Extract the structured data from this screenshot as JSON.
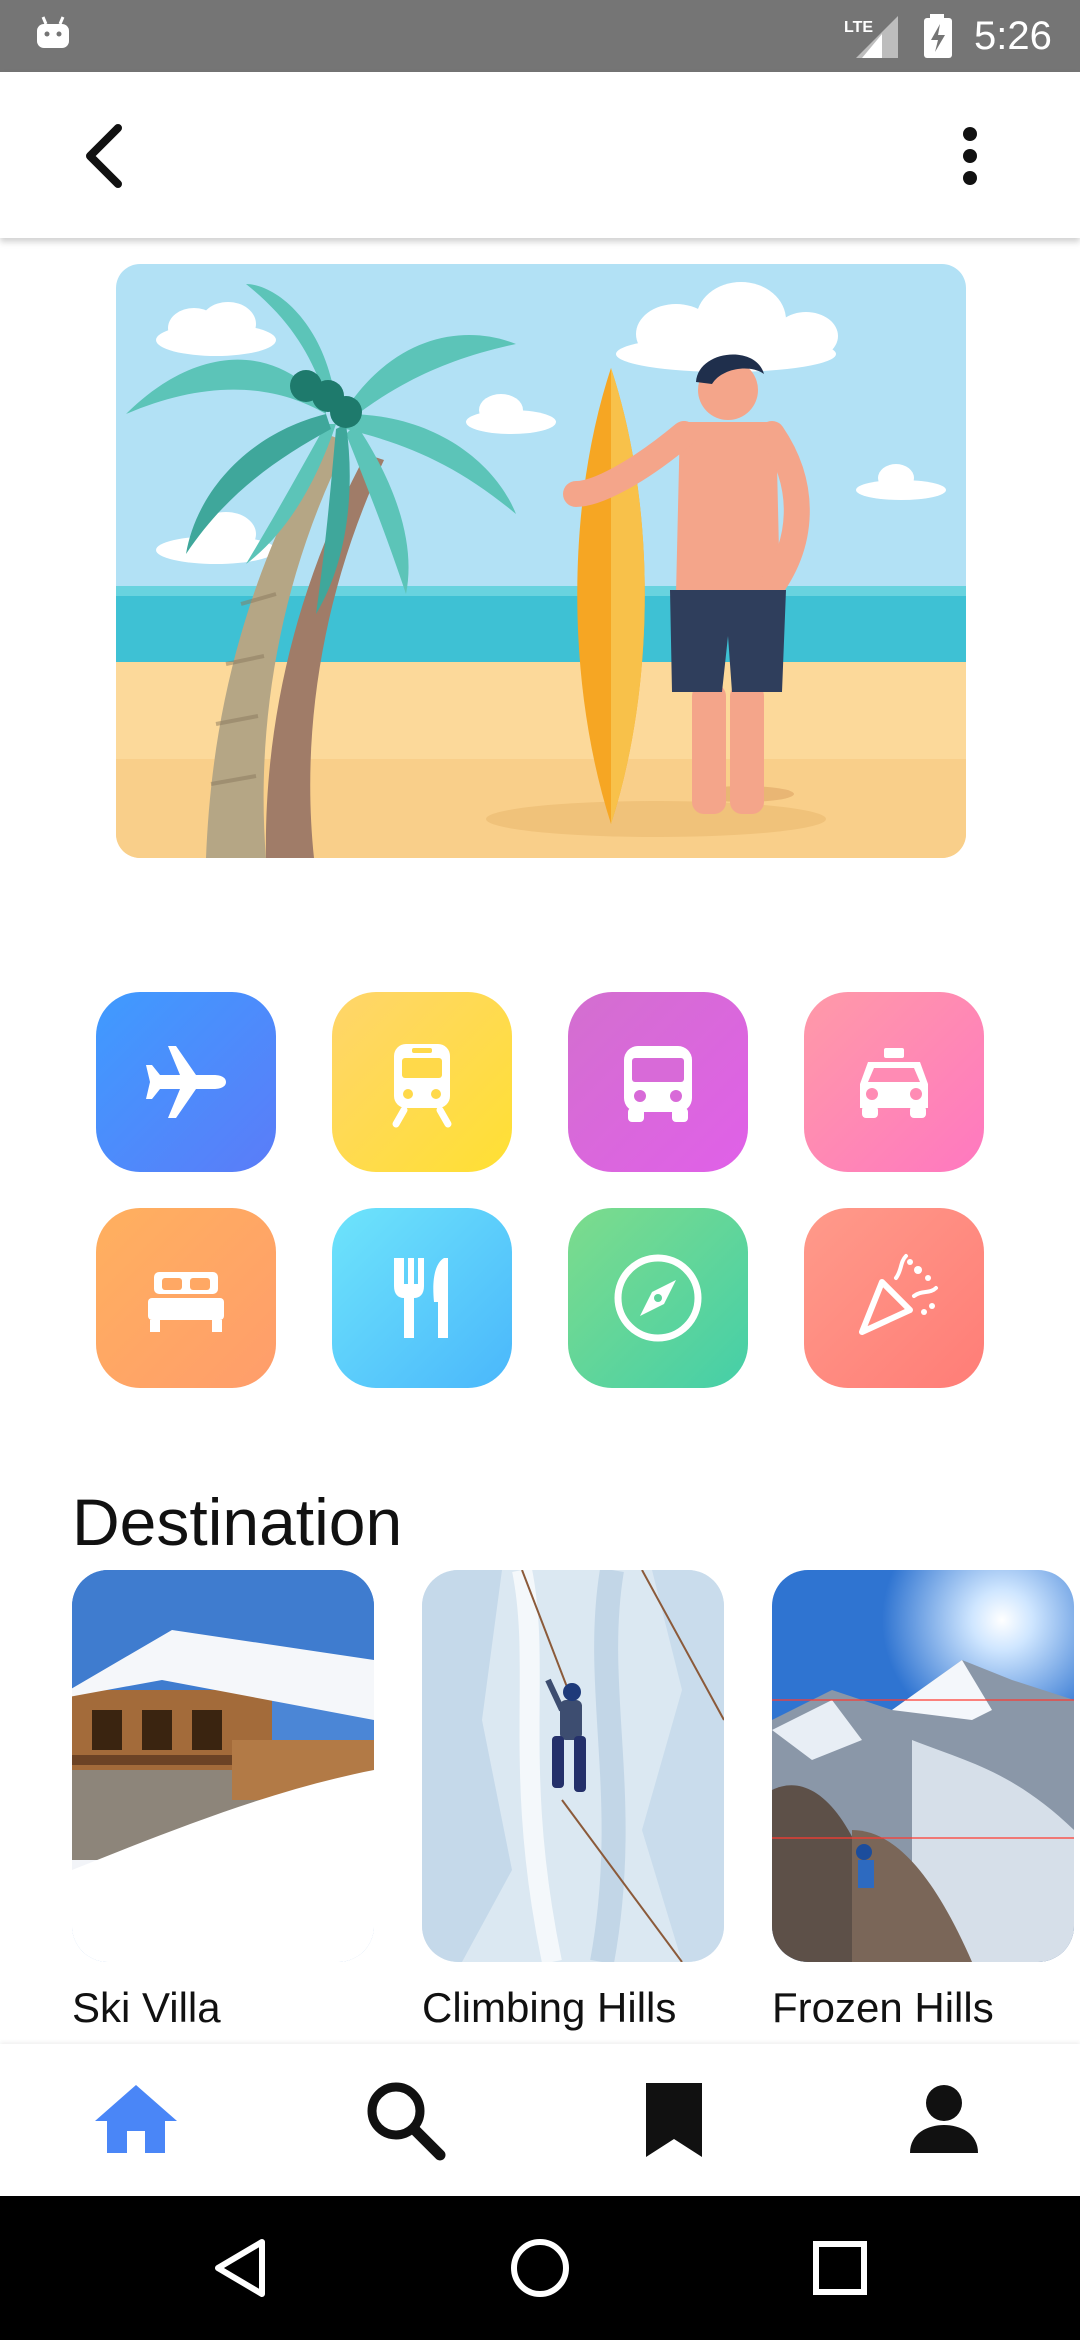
{
  "status_bar": {
    "time": "5:26",
    "network": "LTE"
  },
  "app_bar": {
    "back_icon": "chevron-left-icon",
    "menu_icon": "more-vertical-icon"
  },
  "hero": {
    "illustration": "beach-surfer-illustration"
  },
  "categories": [
    {
      "name": "flight",
      "icon": "airplane-icon",
      "color_start": "#3f9bff",
      "color_end": "#5b7cf8"
    },
    {
      "name": "train",
      "icon": "train-icon",
      "color_start": "#ffd56b",
      "color_end": "#ffe033"
    },
    {
      "name": "bus",
      "icon": "bus-icon",
      "color_start": "#d36fcf",
      "color_end": "#e060e8"
    },
    {
      "name": "taxi",
      "icon": "taxi-icon",
      "color_start": "#ff9aa8",
      "color_end": "#ff78c0"
    },
    {
      "name": "hotel",
      "icon": "bed-icon",
      "color_start": "#ffb05f",
      "color_end": "#ff9d6b"
    },
    {
      "name": "restaurant",
      "icon": "fork-knife-icon",
      "color_start": "#6ee4fb",
      "color_end": "#4ab7fb"
    },
    {
      "name": "explore",
      "icon": "compass-icon",
      "color_start": "#7ddc8c",
      "color_end": "#45cfa8"
    },
    {
      "name": "events",
      "icon": "party-popper-icon",
      "color_start": "#ff9a8a",
      "color_end": "#ff7d77"
    }
  ],
  "destination": {
    "title": "Destination",
    "items": [
      {
        "label": "Ski Villa"
      },
      {
        "label": "Climbing Hills"
      },
      {
        "label": "Frozen Hills"
      }
    ]
  },
  "bottom_nav": {
    "active_color": "#4a86f7",
    "items": [
      {
        "icon": "home-icon",
        "active": true
      },
      {
        "icon": "search-icon",
        "active": false
      },
      {
        "icon": "bookmark-icon",
        "active": false
      },
      {
        "icon": "profile-icon",
        "active": false
      }
    ]
  }
}
